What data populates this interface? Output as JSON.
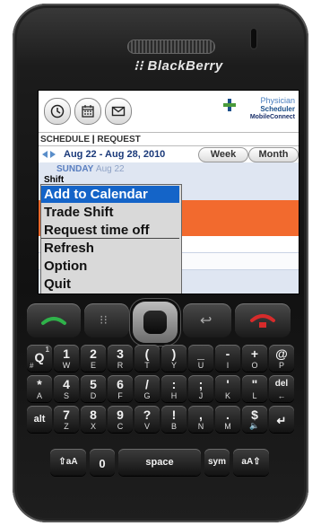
{
  "phone": {
    "brand": "BlackBerry"
  },
  "toolbar": {
    "clock_icon": "clock-icon",
    "calendar_icon": "calendar-icon",
    "mail_icon": "mail-icon"
  },
  "logo": {
    "line1": "Physician",
    "line2": "Scheduler",
    "line3": "MobileConnect"
  },
  "tabs": {
    "schedule": "SCHEDULE",
    "separator": "|",
    "request": "REQUEST"
  },
  "date_range": "Aug 22 - Aug 28, 2010",
  "view_toggle": {
    "week": "Week",
    "month": "Month"
  },
  "day": {
    "name": "SUNDAY",
    "date": "Aug 22"
  },
  "shift_label": "Shift",
  "menu": {
    "items": [
      "Add to Calendar",
      "Trade Shift",
      "Request time off",
      "Refresh",
      "Option",
      "Quit"
    ],
    "selected_index": 0
  },
  "keyboard": {
    "row1": [
      [
        "Q",
        "W",
        "#",
        "1"
      ],
      [
        "W",
        "",
        "1",
        ""
      ],
      [
        "E",
        "2",
        ""
      ],
      [
        "R",
        "3",
        ""
      ],
      [
        "T",
        "(",
        ""
      ],
      [
        "Y",
        ")",
        ""
      ],
      [
        "U",
        "_",
        ""
      ],
      [
        "I",
        "-",
        ""
      ],
      [
        "O",
        "+",
        ""
      ],
      [
        "P",
        "@",
        ""
      ]
    ],
    "space_label": "space",
    "sym_label": "sym",
    "alt_label": "alt",
    "aA_label": "aA",
    "zero_label": "0"
  }
}
